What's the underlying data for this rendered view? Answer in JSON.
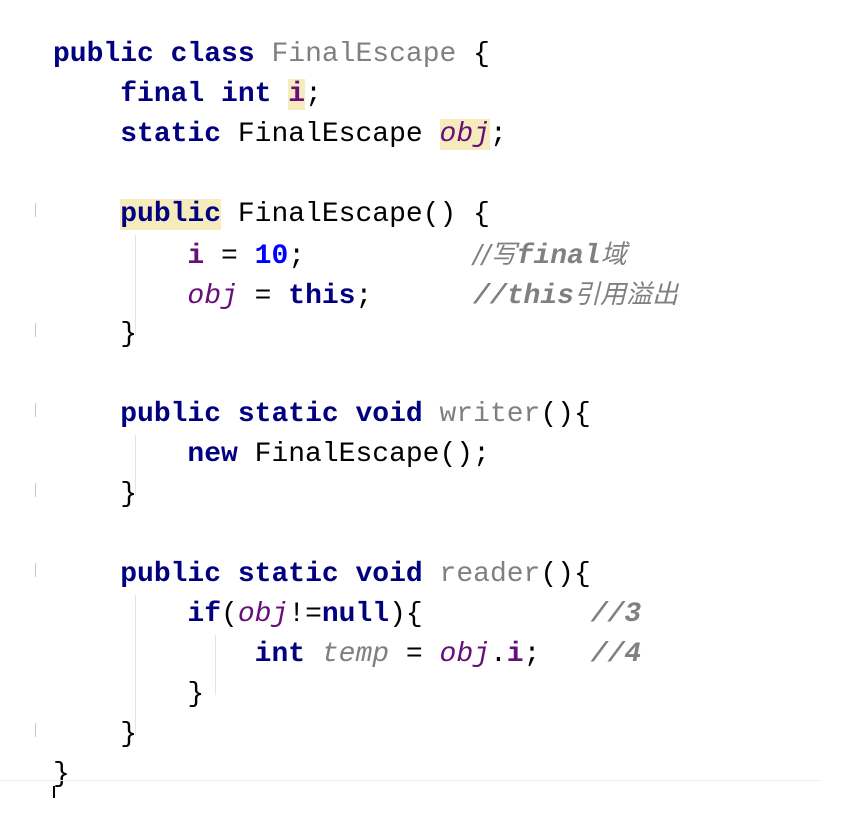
{
  "editor": {
    "code": {
      "class_decl": {
        "kw_public": "public",
        "kw_class": "class",
        "class_name": "FinalEscape",
        "open_brace": " {"
      },
      "field_i": {
        "kw_final": "final",
        "kw_int": "int",
        "name": "i",
        "semi": ";"
      },
      "field_obj": {
        "kw_static": "static",
        "type": "FinalEscape",
        "name": "obj",
        "semi": ";"
      },
      "constructor": {
        "kw_public": "public",
        "signature": " FinalEscape() {",
        "assign_i_name": "i",
        "assign_i_op": " = ",
        "assign_i_value": "10",
        "assign_i_semi": ";",
        "assign_i_pad": "          ",
        "comment1_prefix": "//写",
        "comment1_word": "final",
        "comment1_suffix": "域",
        "assign_obj_name": "obj",
        "assign_obj_op": " = ",
        "assign_obj_value": "this",
        "assign_obj_semi": ";",
        "assign_obj_pad": "      ",
        "comment2_prefix": "//this",
        "comment2_suffix": "引用溢出",
        "close_brace": "}"
      },
      "writer": {
        "kw_public": "public",
        "kw_static": "static",
        "kw_void": "void",
        "name": "writer",
        "params": "(){",
        "kw_new": "new",
        "body_rest": " FinalEscape();",
        "close_brace": "}"
      },
      "reader": {
        "kw_public": "public",
        "kw_static": "static",
        "kw_void": "void",
        "name": "reader",
        "params": "(){",
        "kw_if": "if",
        "cond_open": "(",
        "cond_obj": "obj",
        "cond_op": "!=",
        "cond_null": "null",
        "cond_close": "){",
        "comment3_pad": "          ",
        "comment3": "//3",
        "kw_int": "int",
        "temp_name": "temp",
        "temp_op": " = ",
        "temp_obj": "obj",
        "temp_dot": ".",
        "temp_field": "i",
        "temp_semi": ";",
        "comment4_pad": "   ",
        "comment4": "//4",
        "if_close": "}",
        "close_brace": "}"
      },
      "class_close": "}"
    }
  }
}
